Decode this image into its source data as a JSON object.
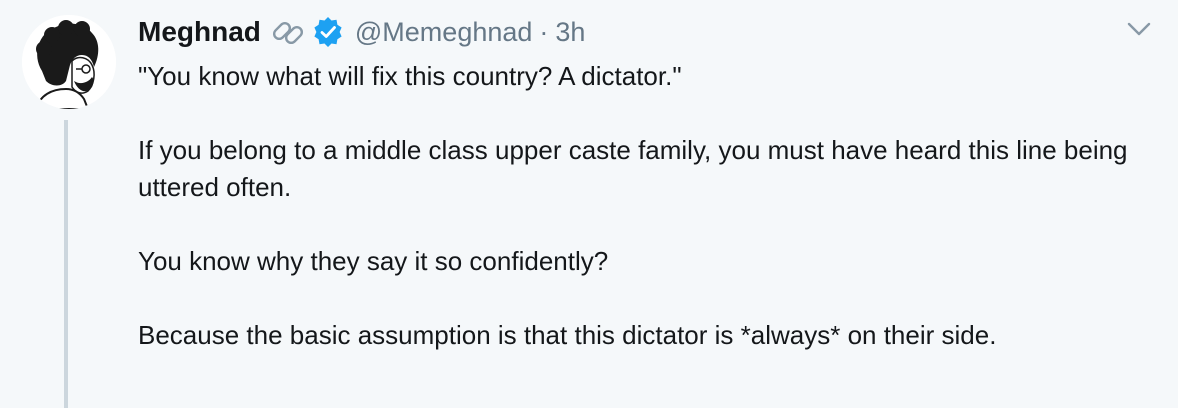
{
  "tweet": {
    "author_name": "Meghnad",
    "handle": "@Memeghnad",
    "separator": "·",
    "time": "3h",
    "paragraphs": [
      "\"You know what will fix this country? A dictator.\"",
      "If you belong to a middle class upper caste family, you must have heard this line being uttered often.",
      "You know why they say it so confidently?",
      "Because the basic assumption is that this dictator is *always* on their side."
    ]
  },
  "icons": {
    "link": "link-icon",
    "verified": "verified-badge-icon",
    "menu": "chevron-down-icon"
  },
  "colors": {
    "background": "#f5f8fa",
    "text": "#14171a",
    "secondary": "#657786",
    "verified": "#1da1f2",
    "thread_line": "#ccd6dd"
  }
}
